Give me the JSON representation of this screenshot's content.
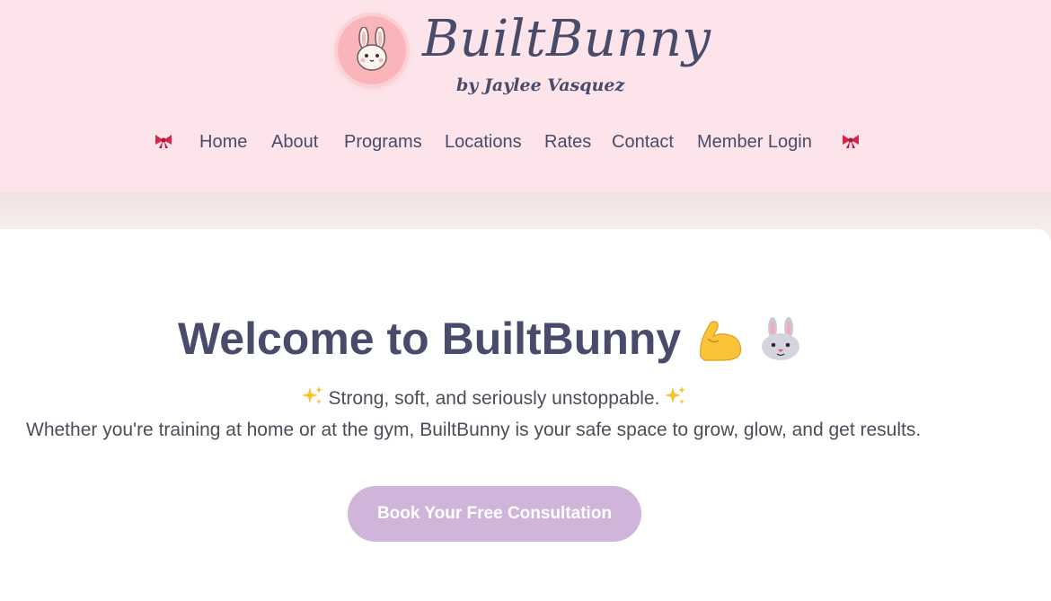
{
  "brand": {
    "title": "BuiltBunny",
    "subtitle": "by Jaylee Vasquez",
    "logo_icon": "bunny-face-icon"
  },
  "nav": {
    "left_decoration_icon": "ribbon-bow-icon",
    "right_decoration_icon": "ribbon-bow-icon",
    "items": [
      "Home",
      "About",
      "Programs",
      "Locations",
      "Rates",
      "Contact",
      "Member Login"
    ]
  },
  "hero": {
    "heading": "Welcome to BuiltBunny",
    "heading_icons": [
      "flexed-biceps-icon",
      "rabbit-face-icon"
    ],
    "tagline": "Strong, soft, and seriously unstoppable.",
    "tagline_icons": [
      "sparkles-icon",
      "sparkles-icon"
    ],
    "description": "Whether you're training at home or at the gym, BuiltBunny is your safe space to grow, glow, and get results.",
    "cta_label": "Book Your Free Consultation"
  },
  "colors": {
    "header_bg": "#fde4ea",
    "text_dark": "#484b6a",
    "cta_bg": "#cfb5da",
    "logo_bg": "#f9b5ba"
  }
}
